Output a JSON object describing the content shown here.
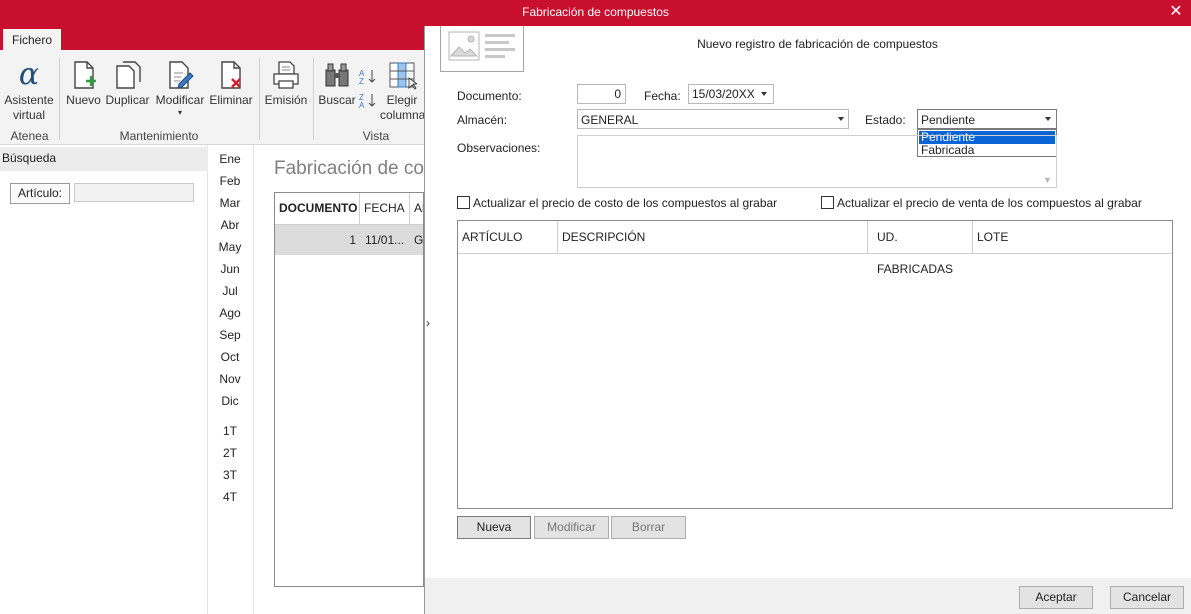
{
  "window": {
    "title": "Fabricación de compuestos"
  },
  "ribbon": {
    "tab": "Fichero",
    "buttons": {
      "asistente_1": "Asistente",
      "asistente_2": "virtual",
      "nuevo": "Nuevo",
      "duplicar": "Duplicar",
      "modificar": "Modificar",
      "eliminar": "Eliminar",
      "emision": "Emisión",
      "buscar": "Buscar",
      "elegir_1": "Elegir",
      "elegir_2": "columna"
    },
    "groups": {
      "atenea": "Atenea",
      "mantenimiento": "Mantenimiento",
      "vista": "Vista"
    }
  },
  "search_panel": {
    "header": "Búsqueda",
    "articulo_label": "Artículo:",
    "articulo_value": ""
  },
  "periods": {
    "months": [
      "Ene",
      "Feb",
      "Mar",
      "Abr",
      "May",
      "Jun",
      "Jul",
      "Ago",
      "Sep",
      "Oct",
      "Nov",
      "Dic"
    ],
    "quarters": [
      "1T",
      "2T",
      "3T",
      "4T"
    ]
  },
  "list": {
    "title": "Fabricación de co",
    "columns": [
      "DOCUMENTO",
      "FECHA",
      "Al"
    ],
    "rows": [
      {
        "documento": "1",
        "fecha": "11/01...",
        "almacen": "Gl"
      }
    ]
  },
  "dialog": {
    "title": "Nuevo registro de fabricación de compuestos",
    "arrow": "›",
    "labels": {
      "documento": "Documento:",
      "fecha": "Fecha:",
      "almacen": "Almacén:",
      "estado": "Estado:",
      "observaciones": "Observaciones:"
    },
    "values": {
      "documento": "0",
      "fecha": "15/03/20XX",
      "almacen": "GENERAL",
      "estado": "Pendiente",
      "observaciones": ""
    },
    "estado_options": [
      "Pendiente",
      "Fabricada"
    ],
    "checkboxes": {
      "costo": "Actualizar el precio de costo de los compuestos al grabar",
      "venta": "Actualizar el precio de venta de los compuestos al grabar"
    },
    "grid_columns": [
      "ARTÍCULO",
      "DESCRIPCIÓN",
      "UD. FABRICADAS",
      "LOTE"
    ],
    "grid_buttons": {
      "nueva": "Nueva",
      "modificar": "Modificar",
      "borrar": "Borrar"
    },
    "footer": {
      "aceptar": "Aceptar",
      "cancelar": "Cancelar"
    }
  },
  "colors": {
    "brand": "#c8102e",
    "selection": "#0a64d6"
  }
}
